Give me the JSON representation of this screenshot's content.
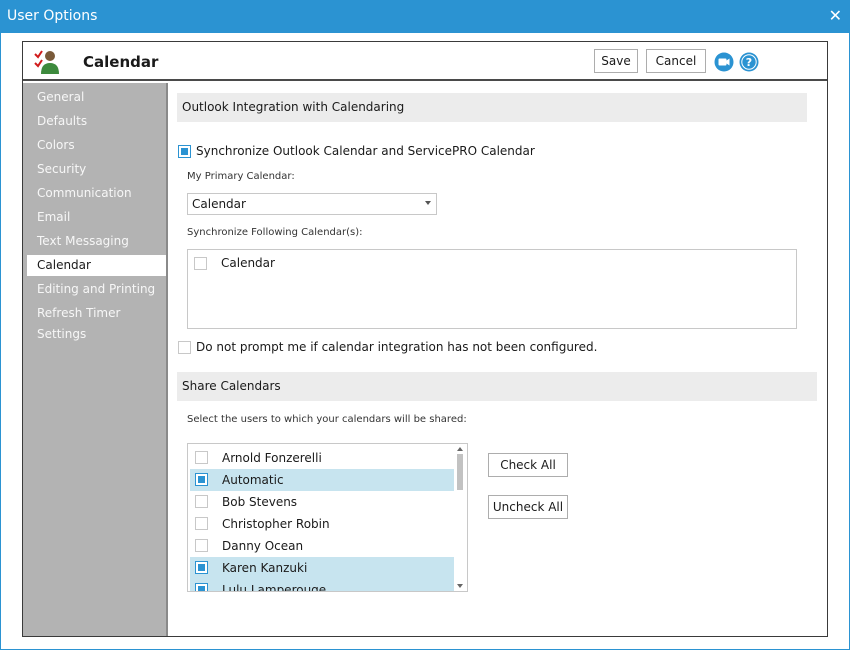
{
  "window": {
    "title": "User Options",
    "close_glyph": "✕"
  },
  "header": {
    "title": "Calendar",
    "save_label": "Save",
    "cancel_label": "Cancel",
    "video_icon": "video-icon",
    "help_icon": "help-icon"
  },
  "sidebar": {
    "items": [
      {
        "label": "General",
        "active": false
      },
      {
        "label": "Defaults",
        "active": false
      },
      {
        "label": "Colors",
        "active": false
      },
      {
        "label": "Security",
        "active": false
      },
      {
        "label": "Communication",
        "active": false
      },
      {
        "label": "Email",
        "active": false
      },
      {
        "label": "Text Messaging",
        "active": false
      },
      {
        "label": "Calendar",
        "active": true
      },
      {
        "label": "Editing and Printing",
        "active": false
      },
      {
        "label": "Refresh Timer Settings",
        "active": false
      }
    ]
  },
  "outlook": {
    "section_title": "Outlook Integration with Calendaring",
    "sync_label": "Synchronize Outlook Calendar and ServicePRO Calendar",
    "sync_checked": true,
    "primary_label": "My Primary Calendar:",
    "primary_value": "Calendar",
    "following_label": "Synchronize Following Calendar(s):",
    "following_items": [
      {
        "label": "Calendar",
        "checked": false
      }
    ],
    "no_prompt_label": "Do not prompt me if calendar integration has not been configured.",
    "no_prompt_checked": false
  },
  "share": {
    "section_title": "Share Calendars",
    "instruction": "Select the users to which your calendars will be shared:",
    "check_all_label": "Check All",
    "uncheck_all_label": "Uncheck All",
    "users": [
      {
        "name": "Arnold Fonzerelli",
        "checked": false
      },
      {
        "name": "Automatic",
        "checked": true
      },
      {
        "name": "Bob Stevens",
        "checked": false
      },
      {
        "name": "Christopher Robin",
        "checked": false
      },
      {
        "name": "Danny Ocean",
        "checked": false
      },
      {
        "name": "Karen Kanzuki",
        "checked": true
      },
      {
        "name": "Lulu Lamperouge",
        "checked": true
      }
    ]
  },
  "colors": {
    "accent": "#2b93d2",
    "sidebar": "#b3b3b3",
    "selected_row": "#c7e4ef"
  }
}
